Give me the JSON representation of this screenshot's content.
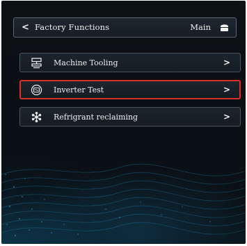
{
  "header": {
    "back_glyph": "<",
    "title": "Factory Functions",
    "main_label": "Main",
    "home_icon": "home-icon"
  },
  "menu": {
    "items": [
      {
        "label": "Machine Tooling",
        "icon": "machine-tooling-icon",
        "chevron": ">",
        "selected": false
      },
      {
        "label": "Inverter Test",
        "icon": "inverter-icon",
        "chevron": ">",
        "selected": true
      },
      {
        "label": "Refrigrant reclaiming",
        "icon": "snowflake-icon",
        "chevron": ">",
        "selected": false
      }
    ]
  },
  "colors": {
    "background": "#0b1014",
    "selection_border": "#d8322b",
    "text": "#f0f0f0",
    "item_border": "#4a5560"
  }
}
